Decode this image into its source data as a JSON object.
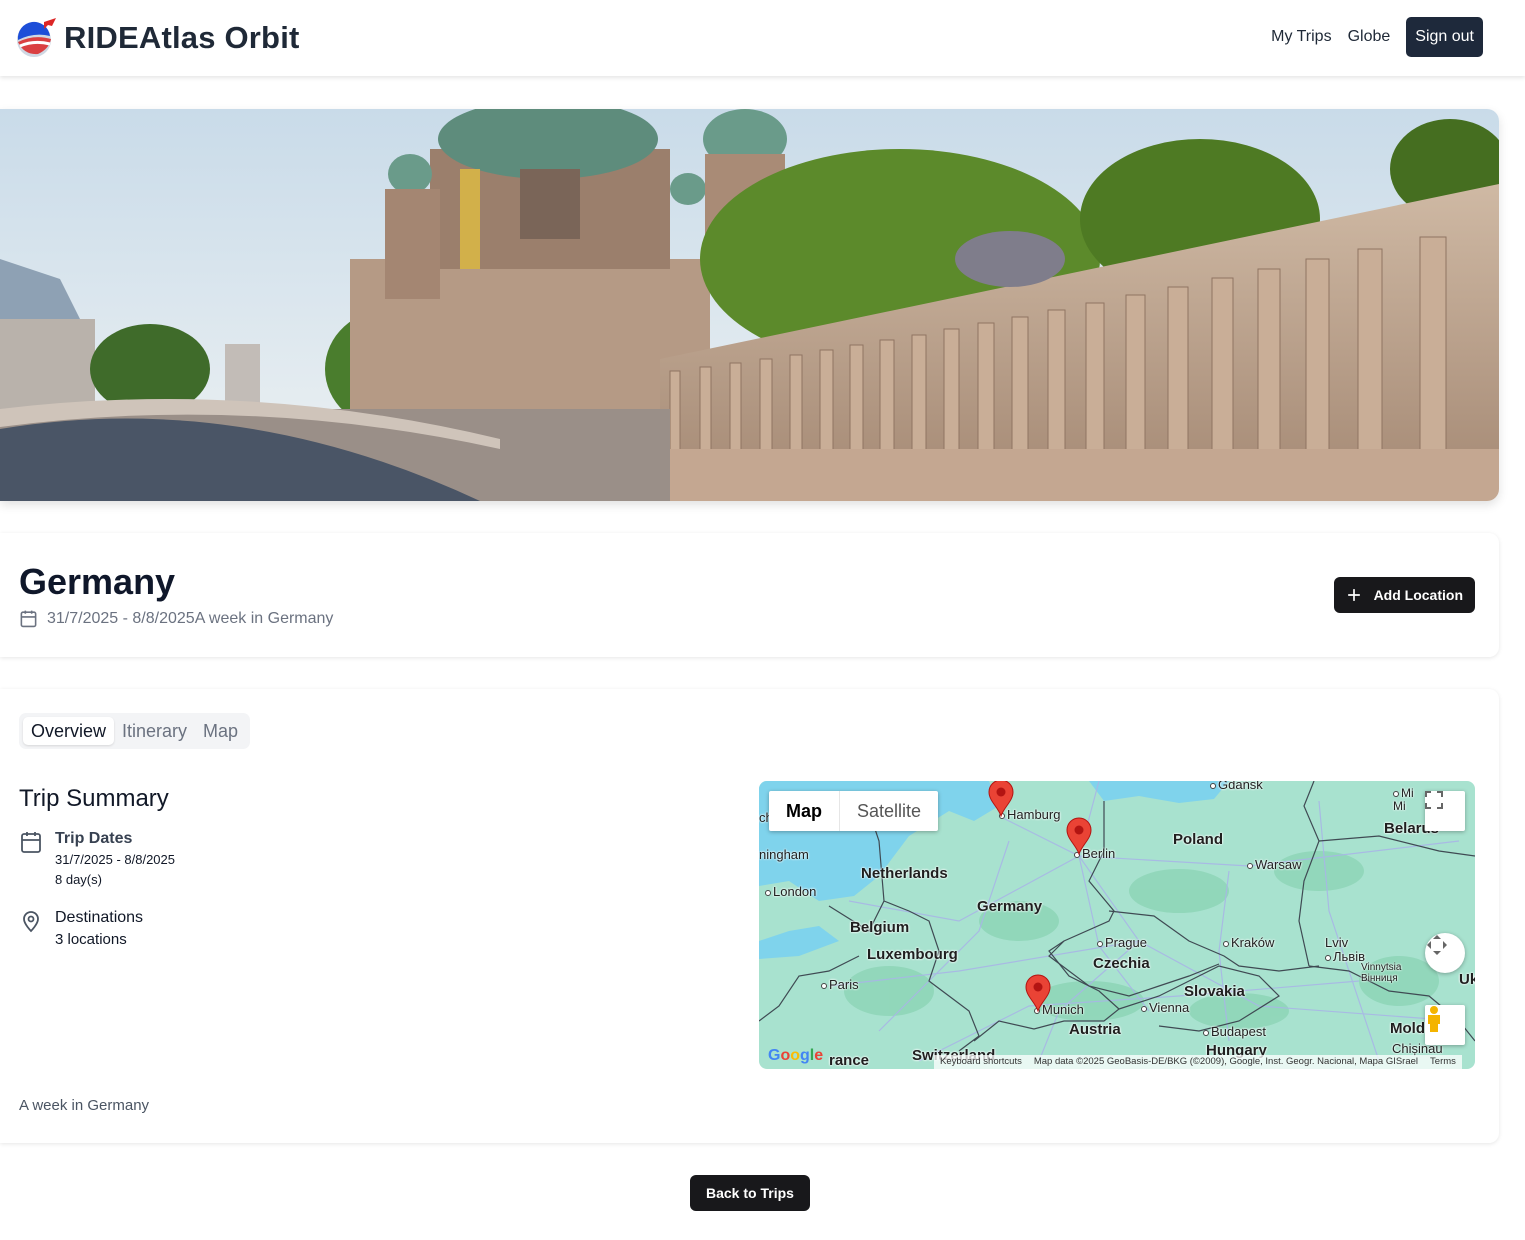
{
  "header": {
    "brand": "RIDEAtlas Orbit",
    "nav": [
      "My Trips",
      "Globe"
    ],
    "signout": "Sign out"
  },
  "trip": {
    "title": "Germany",
    "dates": "31/7/2025 - 8/8/2025",
    "tagline": "A week in Germany",
    "add_location": "Add Location"
  },
  "tabs": {
    "overview": "Overview",
    "itinerary": "Itinerary",
    "map": "Map",
    "active": "Overview"
  },
  "summary": {
    "title": "Trip Summary",
    "dates_label": "Trip Dates",
    "dates_value": "31/7/2025 - 8/8/2025",
    "days": "8 day(s)",
    "destinations_label": "Destinations",
    "destinations_value": "3 locations",
    "description": "A week in Germany"
  },
  "map": {
    "type_map": "Map",
    "type_satellite": "Satellite",
    "google": "Google",
    "keyboard": "Keyboard shortcuts",
    "attribution": "Map data ©2025 GeoBasis-DE/BKG (©2009), Google, Inst. Geogr. Nacional, Mapa GISrael",
    "terms": "Terms",
    "countries": [
      "Poland",
      "Netherlands",
      "Germany",
      "Belgium",
      "Luxembourg",
      "Czechia",
      "Slovakia",
      "Austria",
      "Hungary",
      "Switzerland",
      "Belarus",
      "Mold",
      "Uk",
      "rance"
    ],
    "cities": [
      "Gdańsk",
      "Hamburg",
      "Berlin",
      "Warsaw",
      "London",
      "Prague",
      "Kraków",
      "Lviv",
      "Львів",
      "Paris",
      "Vienna",
      "Munich",
      "Budapest",
      "Chișinău",
      "Vinnytsia",
      "Вінниця",
      "Mi",
      "Mi",
      "ningham",
      "ch"
    ],
    "markers": [
      "Hamburg",
      "Berlin",
      "Munich"
    ]
  },
  "footer": {
    "back": "Back to Trips"
  },
  "colors": {
    "primary_dark": "#18181b",
    "nav_button": "#1e293b",
    "map_land": "#a8e2cf",
    "map_water": "#7fd3ec",
    "marker": "#ea4335"
  }
}
